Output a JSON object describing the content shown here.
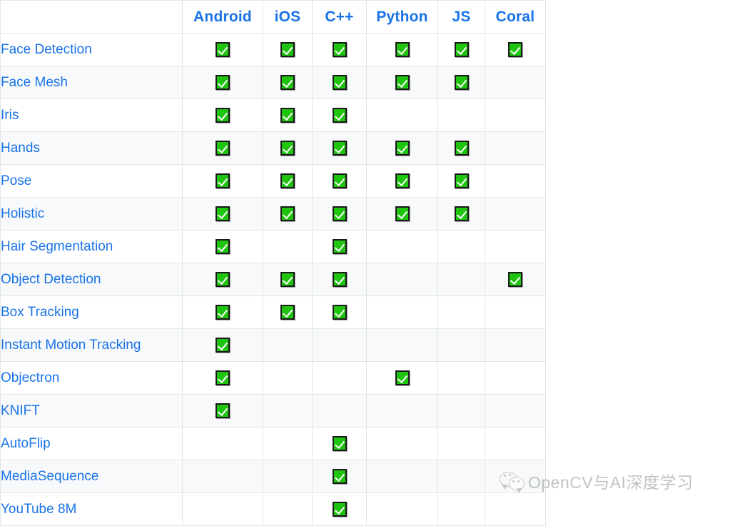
{
  "table": {
    "columns": [
      {
        "key": "solution",
        "label": ""
      },
      {
        "key": "android",
        "label": "Android"
      },
      {
        "key": "ios",
        "label": "iOS"
      },
      {
        "key": "cpp",
        "label": "C++"
      },
      {
        "key": "python",
        "label": "Python"
      },
      {
        "key": "js",
        "label": "JS"
      },
      {
        "key": "coral",
        "label": "Coral"
      }
    ],
    "rows": [
      {
        "solution": "Face Detection",
        "android": "yes",
        "ios": "yes",
        "cpp": "yes",
        "python": "yes",
        "js": "yes",
        "coral": "yes"
      },
      {
        "solution": "Face Mesh",
        "android": "yes",
        "ios": "yes",
        "cpp": "yes",
        "python": "yes",
        "js": "yes",
        "coral": ""
      },
      {
        "solution": "Iris",
        "android": "yes",
        "ios": "yes",
        "cpp": "yes",
        "python": "",
        "js": "",
        "coral": ""
      },
      {
        "solution": "Hands",
        "android": "yes",
        "ios": "yes",
        "cpp": "yes",
        "python": "yes",
        "js": "yes",
        "coral": ""
      },
      {
        "solution": "Pose",
        "android": "yes",
        "ios": "yes",
        "cpp": "yes",
        "python": "yes",
        "js": "yes",
        "coral": ""
      },
      {
        "solution": "Holistic",
        "android": "yes",
        "ios": "yes",
        "cpp": "yes",
        "python": "yes",
        "js": "yes",
        "coral": ""
      },
      {
        "solution": "Hair Segmentation",
        "android": "yes",
        "ios": "",
        "cpp": "yes",
        "python": "",
        "js": "",
        "coral": ""
      },
      {
        "solution": "Object Detection",
        "android": "yes",
        "ios": "yes",
        "cpp": "yes",
        "python": "",
        "js": "",
        "coral": "yes"
      },
      {
        "solution": "Box Tracking",
        "android": "yes",
        "ios": "yes",
        "cpp": "yes",
        "python": "",
        "js": "",
        "coral": ""
      },
      {
        "solution": "Instant Motion Tracking",
        "android": "yes",
        "ios": "",
        "cpp": "",
        "python": "",
        "js": "",
        "coral": ""
      },
      {
        "solution": "Objectron",
        "android": "yes",
        "ios": "",
        "cpp": "",
        "python": "yes",
        "js": "",
        "coral": ""
      },
      {
        "solution": "KNIFT",
        "android": "yes",
        "ios": "",
        "cpp": "",
        "python": "",
        "js": "",
        "coral": ""
      },
      {
        "solution": "AutoFlip",
        "android": "",
        "ios": "",
        "cpp": "yes",
        "python": "",
        "js": "",
        "coral": ""
      },
      {
        "solution": "MediaSequence",
        "android": "",
        "ios": "",
        "cpp": "yes",
        "python": "",
        "js": "",
        "coral": ""
      },
      {
        "solution": "YouTube 8M",
        "android": "",
        "ios": "",
        "cpp": "yes",
        "python": "",
        "js": "",
        "coral": ""
      }
    ]
  },
  "watermark": {
    "text": "OpenCV与AI深度学习",
    "logo": "wechat-icon"
  },
  "colors": {
    "link_blue": "#1a73e8",
    "check_green": "#1fc40f",
    "row_alt": "#f7f9fa",
    "border": "#e3e6e8"
  }
}
